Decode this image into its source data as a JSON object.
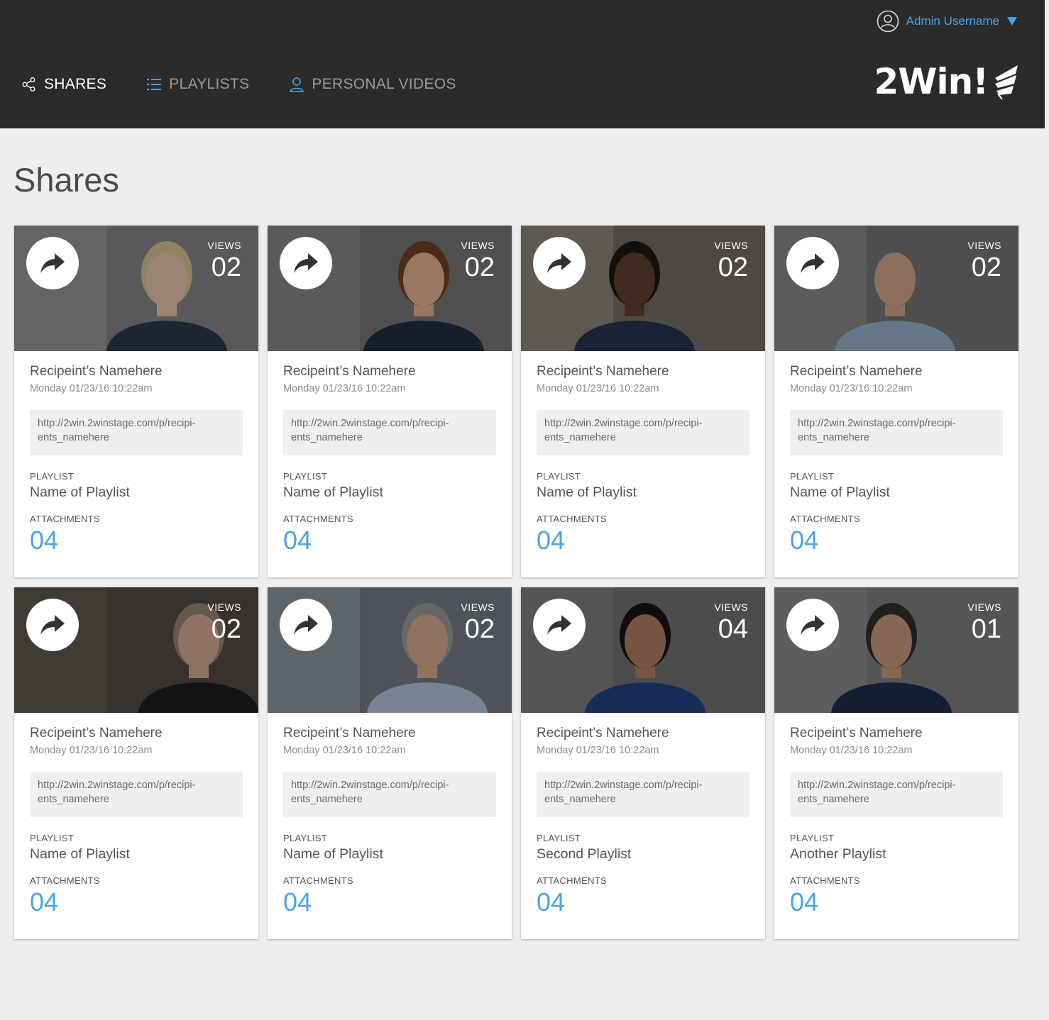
{
  "header": {
    "username": "Admin Username",
    "logo_text": "2Win!",
    "nav": [
      {
        "label": "SHARES",
        "icon": "share-icon",
        "active": true
      },
      {
        "label": "PLAYLISTS",
        "icon": "list-icon",
        "active": false
      },
      {
        "label": "PERSONAL VIDEOS",
        "icon": "person-icon",
        "active": false
      }
    ]
  },
  "page": {
    "title": "Shares"
  },
  "labels": {
    "views": "VIEWS",
    "playlist": "PLAYLIST",
    "attachments": "ATTACHMENTS"
  },
  "colors": {
    "accent": "#4aa3e8",
    "header_bg": "#2b2b2b",
    "page_bg": "#eeeeee"
  },
  "cards": [
    {
      "recipient": "Recipeint’s Namehere",
      "date": "Monday 01/23/16 10:22am",
      "link_line1": "http://2win.2winstage.com/p/recipi-",
      "link_line2": "ents_namehere",
      "views": "02",
      "playlist": "Name of Playlist",
      "attachments": "04",
      "photo": "woman-blonde-office"
    },
    {
      "recipient": "Recipeint’s Namehere",
      "date": "Monday 01/23/16 10:22am",
      "link_line1": "http://2win.2winstage.com/p/recipi-",
      "link_line2": "ents_namehere",
      "views": "02",
      "playlist": "Name of Playlist",
      "attachments": "04",
      "photo": "woman-curly-blazer"
    },
    {
      "recipient": "Recipeint’s Namehere",
      "date": "Monday 01/23/16 10:22am",
      "link_line1": "http://2win.2winstage.com/p/recipi-",
      "link_line2": "ents_namehere",
      "views": "02",
      "playlist": "Name of Playlist",
      "attachments": "04",
      "photo": "man-glasses-suit"
    },
    {
      "recipient": "Recipeint’s Namehere",
      "date": "Monday 01/23/16 10:22am",
      "link_line1": "http://2win.2winstage.com/p/recipi-",
      "link_line2": "ents_namehere",
      "views": "02",
      "playlist": "Name of Playlist",
      "attachments": "04",
      "photo": "man-glasses-blue-shirt"
    },
    {
      "recipient": "Recipeint’s Namehere",
      "date": "Monday 01/23/16 10:22am",
      "link_line1": "http://2win.2winstage.com/p/recipi-",
      "link_line2": "ents_namehere",
      "views": "02",
      "playlist": "Name of Playlist",
      "attachments": "04",
      "photo": "man-bald-suit-brick"
    },
    {
      "recipient": "Recipeint’s Namehere",
      "date": "Monday 01/23/16 10:22am",
      "link_line1": "http://2win.2winstage.com/p/recipi-",
      "link_line2": "ents_namehere",
      "views": "02",
      "playlist": "Name of Playlist",
      "attachments": "04",
      "photo": "man-shirt-tie-office"
    },
    {
      "recipient": "Recipeint’s Namehere",
      "date": "Monday 01/23/16 10:22am",
      "link_line1": "http://2win.2winstage.com/p/recipi-",
      "link_line2": "ents_namehere",
      "views": "04",
      "playlist": "Second Playlist",
      "attachments": "04",
      "photo": "woman-dark-hair-blue-top"
    },
    {
      "recipient": "Recipeint’s Namehere",
      "date": "Monday 01/23/16 10:22am",
      "link_line1": "http://2win.2winstage.com/p/recipi-",
      "link_line2": "ents_namehere",
      "views": "01",
      "playlist": "Another Playlist",
      "attachments": "04",
      "photo": "man-blazer-white-wall"
    }
  ]
}
